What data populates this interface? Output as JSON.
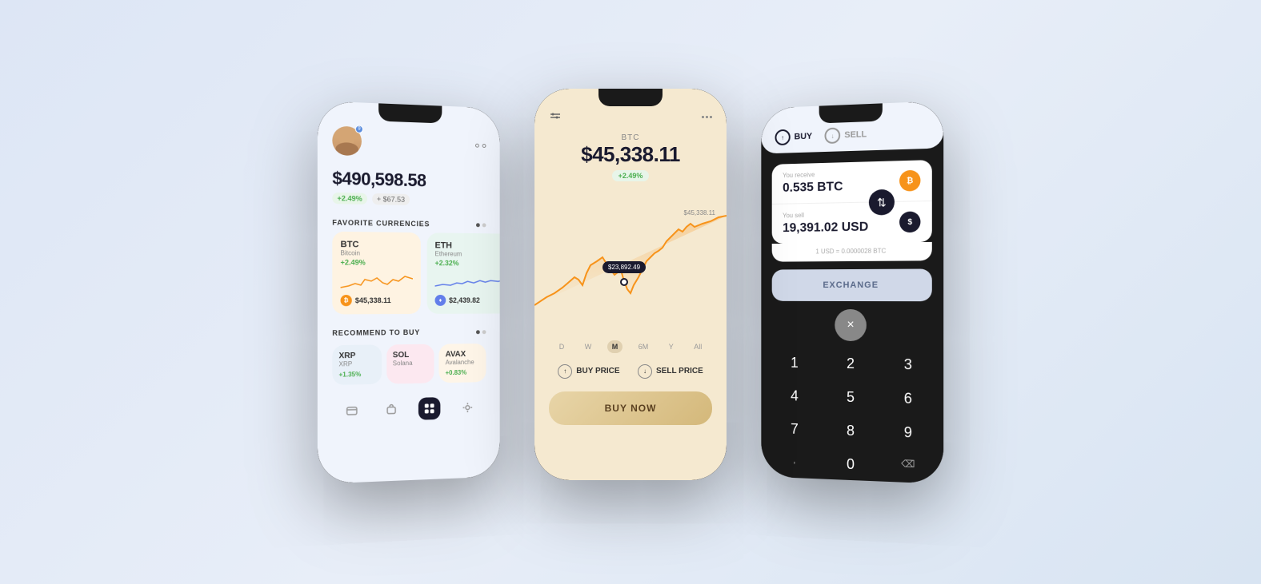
{
  "left_phone": {
    "balance": "$490,598.58",
    "change_pct": "+2.49%",
    "change_abs": "+ $67.53",
    "section_fav": "FAVORITE CURRENCIES",
    "section_rec": "RECOMMEND TO BUY",
    "btc": {
      "ticker": "BTC",
      "name": "Bitcoin",
      "change": "+2.49%",
      "price": "$45,338.11"
    },
    "eth": {
      "ticker": "ETH",
      "name": "Ethereum",
      "change": "+2.32%",
      "price": "$2,439.82"
    },
    "xrp": {
      "ticker": "XRP",
      "name": "XRP",
      "change": "+1.35%"
    },
    "sol": {
      "ticker": "SOL",
      "name": "Solana",
      "change": ""
    },
    "avax": {
      "ticker": "AVAX",
      "name": "Avalanche",
      "change": "+0.83%"
    }
  },
  "center_phone": {
    "ticker": "BTC",
    "price": "$45,338.11",
    "change": "+2.49%",
    "chart_high_label": "$45,338.11",
    "chart_low_label": "$23,892.49",
    "time_tabs": [
      "D",
      "W",
      "M",
      "6M",
      "Y",
      "All"
    ],
    "active_tab": "M",
    "buy_price_label": "BUY PRICE",
    "sell_price_label": "SELL PRICE",
    "buy_now_label": "BUY NOW"
  },
  "right_phone": {
    "tab_buy": "BUY",
    "tab_sell": "SELL",
    "receive_label": "You receive",
    "receive_value": "0.535 BTC",
    "sell_label": "You sell",
    "sell_value": "19,391.02 USD",
    "rate_text": "1 USD = 0.0000028 BTC",
    "exchange_label": "EXCHANGE",
    "close_label": "×",
    "numpad": [
      "1",
      "2",
      "3",
      "4",
      "5",
      "6",
      "7",
      "8",
      "9",
      ",",
      "0",
      "⌫"
    ]
  }
}
